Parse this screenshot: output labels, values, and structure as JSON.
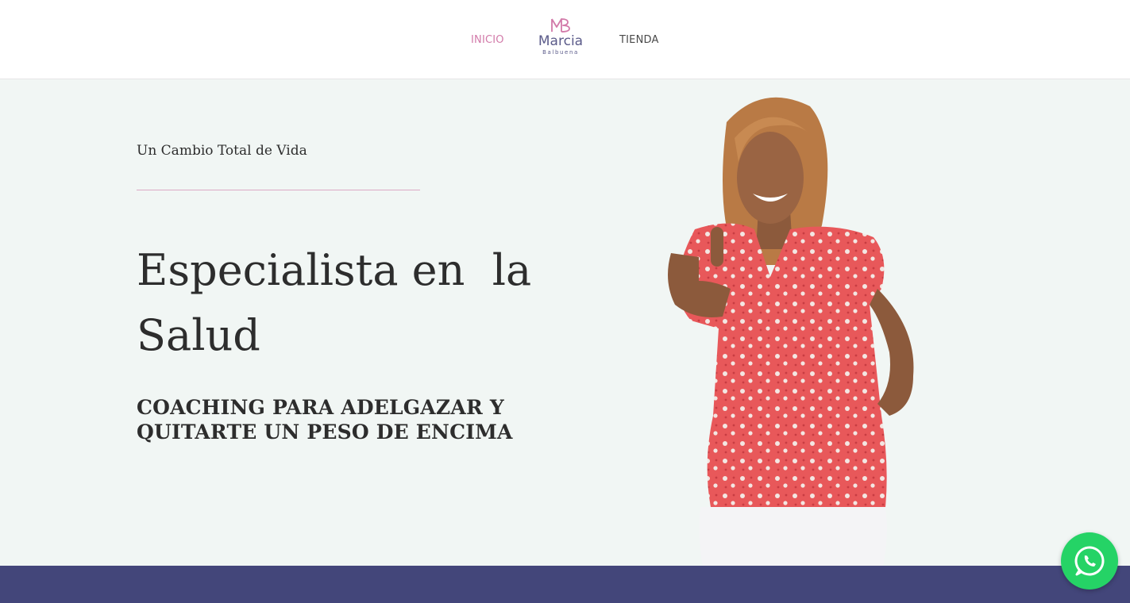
{
  "nav": {
    "items": [
      {
        "label": "INICIO",
        "active": true
      },
      {
        "label": "TIENDA",
        "active": false
      }
    ]
  },
  "logo": {
    "name": "Marcia",
    "sub": "Balbuena",
    "mark_icon": "mb-monogram-icon"
  },
  "hero": {
    "kicker": "Un Cambio Total de Vida",
    "title": "Especialista en  la Salud",
    "subtitle_line1": "COACHING PARA ADELGAZAR Y",
    "subtitle_line2": "QUITARTE UN PESO DE ENCIMA"
  },
  "whatsapp": {
    "icon": "whatsapp-icon"
  },
  "colors": {
    "accent_pink": "#d27aa9",
    "brand_purple": "#5b5b8a",
    "hero_bg": "#f1f6f4",
    "band": "#43467a",
    "whatsapp_green": "#25d366"
  }
}
